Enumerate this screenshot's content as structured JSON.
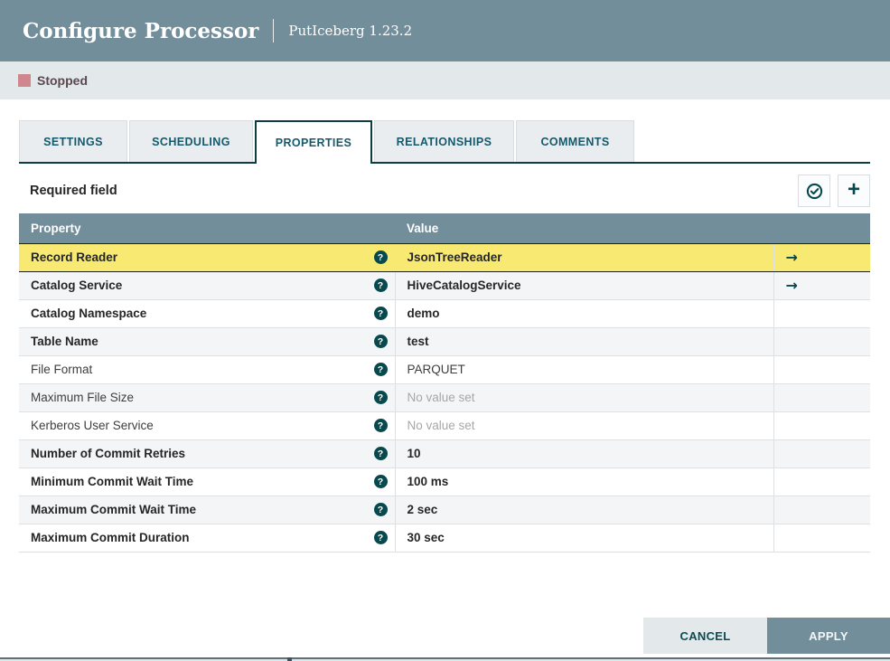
{
  "dialog": {
    "title": "Configure Processor",
    "subtitle": "PutIceberg 1.23.2"
  },
  "status": {
    "label": "Stopped",
    "color": "#CF868C"
  },
  "tabs": [
    {
      "label": "SETTINGS",
      "active": false
    },
    {
      "label": "SCHEDULING",
      "active": false
    },
    {
      "label": "PROPERTIES",
      "active": true
    },
    {
      "label": "RELATIONSHIPS",
      "active": false
    },
    {
      "label": "COMMENTS",
      "active": false
    }
  ],
  "panel": {
    "required_field_label": "Required field"
  },
  "icons": {
    "verify": "circle-check",
    "add": "+",
    "help": "?",
    "goto": "→"
  },
  "table": {
    "columns": [
      "Property",
      "Value",
      ""
    ],
    "rows": [
      {
        "property": "Record Reader",
        "value": "JsonTreeReader",
        "required": true,
        "unset": false,
        "has_link": true,
        "highlighted": true
      },
      {
        "property": "Catalog Service",
        "value": "HiveCatalogService",
        "required": true,
        "unset": false,
        "has_link": true,
        "highlighted": false
      },
      {
        "property": "Catalog Namespace",
        "value": "demo",
        "required": true,
        "unset": false,
        "has_link": false,
        "highlighted": false
      },
      {
        "property": "Table Name",
        "value": "test",
        "required": true,
        "unset": false,
        "has_link": false,
        "highlighted": false
      },
      {
        "property": "File Format",
        "value": "PARQUET",
        "required": false,
        "unset": false,
        "has_link": false,
        "highlighted": false
      },
      {
        "property": "Maximum File Size",
        "value": "No value set",
        "required": false,
        "unset": true,
        "has_link": false,
        "highlighted": false
      },
      {
        "property": "Kerberos User Service",
        "value": "No value set",
        "required": false,
        "unset": true,
        "has_link": false,
        "highlighted": false
      },
      {
        "property": "Number of Commit Retries",
        "value": "10",
        "required": true,
        "unset": false,
        "has_link": false,
        "highlighted": false
      },
      {
        "property": "Minimum Commit Wait Time",
        "value": "100 ms",
        "required": true,
        "unset": false,
        "has_link": false,
        "highlighted": false
      },
      {
        "property": "Maximum Commit Wait Time",
        "value": "2 sec",
        "required": true,
        "unset": false,
        "has_link": false,
        "highlighted": false
      },
      {
        "property": "Maximum Commit Duration",
        "value": "30 sec",
        "required": true,
        "unset": false,
        "has_link": false,
        "highlighted": false
      }
    ]
  },
  "footer": {
    "cancel_label": "CANCEL",
    "apply_label": "APPLY"
  },
  "colors": {
    "header_bg": "#728E9B",
    "status_bar_bg": "#E3E8EB",
    "highlight_row": "#F7E972",
    "accent_teal": "#07494D",
    "tab_border_dark": "#0C3D42"
  }
}
